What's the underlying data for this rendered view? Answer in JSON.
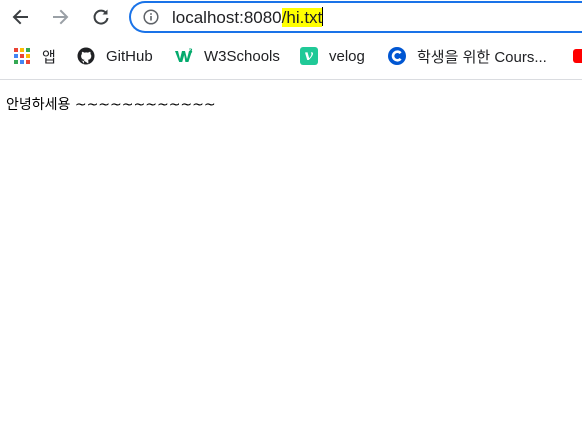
{
  "omnibox": {
    "host": "localhost:8080",
    "path": "/hi.txt"
  },
  "bookmarks": [
    {
      "label": "앱",
      "icon": "apps-grid-icon"
    },
    {
      "label": "GitHub",
      "icon": "github-icon"
    },
    {
      "label": "W3Schools",
      "icon": "w3schools-icon"
    },
    {
      "label": "velog",
      "icon": "velog-icon"
    },
    {
      "label": "학생을 위한 Cours...",
      "icon": "coursera-icon"
    }
  ],
  "page": {
    "text": "안녕하세용 ~~~~~~~~~~~~"
  },
  "colors": {
    "accent": "#1a73e8",
    "highlight": "#ffff00",
    "velog": "#20c997"
  }
}
